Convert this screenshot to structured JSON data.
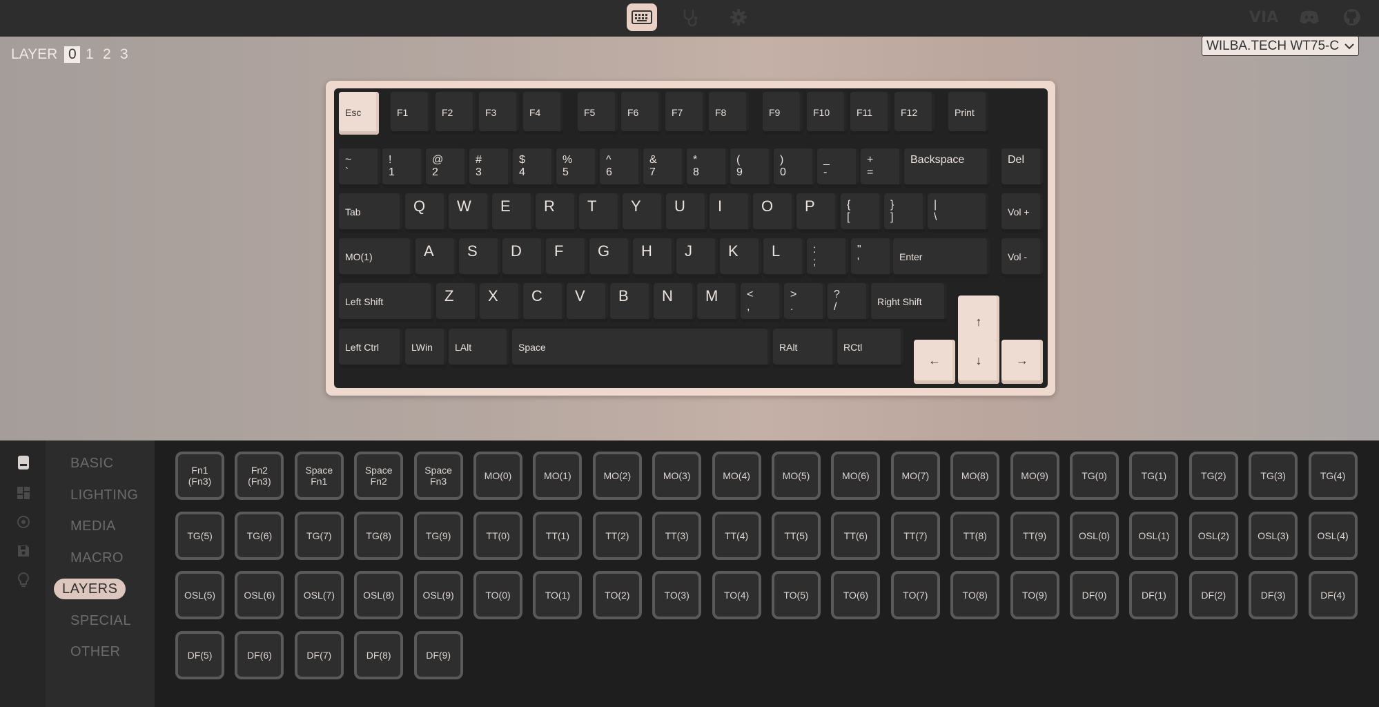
{
  "layer_selector": {
    "label": "LAYER",
    "layers": [
      "0",
      "1",
      "2",
      "3"
    ],
    "active": "0"
  },
  "device": {
    "name": "WILBA.TECH WT75-C"
  },
  "brand": {
    "via": "VIA"
  },
  "keyboard": {
    "row_f": [
      "Esc",
      "F1",
      "F2",
      "F3",
      "F4",
      "F5",
      "F6",
      "F7",
      "F8",
      "F9",
      "F10",
      "F11",
      "F12",
      "Print"
    ],
    "row_num": [
      {
        "top": "~",
        "bot": "`"
      },
      {
        "top": "!",
        "bot": "1"
      },
      {
        "top": "@",
        "bot": "2"
      },
      {
        "top": "#",
        "bot": "3"
      },
      {
        "top": "$",
        "bot": "4"
      },
      {
        "top": "%",
        "bot": "5"
      },
      {
        "top": "^",
        "bot": "6"
      },
      {
        "top": "&",
        "bot": "7"
      },
      {
        "top": "*",
        "bot": "8"
      },
      {
        "top": "(",
        "bot": "9"
      },
      {
        "top": ")",
        "bot": "0"
      },
      {
        "top": "_",
        "bot": "-"
      },
      {
        "top": "+",
        "bot": "="
      },
      {
        "top": "Backspace",
        "bot": ""
      },
      {
        "top": "Del",
        "bot": ""
      }
    ],
    "row_tab": [
      "Tab",
      "Q",
      "W",
      "E",
      "R",
      "T",
      "Y",
      "U",
      "I",
      "O",
      "P",
      {
        "top": "{",
        "bot": "["
      },
      {
        "top": "}",
        "bot": "]"
      },
      {
        "top": "|",
        "bot": "\\"
      },
      "Vol +"
    ],
    "row_caps": [
      "MO(1)",
      "A",
      "S",
      "D",
      "F",
      "G",
      "H",
      "J",
      "K",
      "L",
      {
        "top": ":",
        "bot": ";"
      },
      {
        "top": "\"",
        "bot": "'"
      },
      "Enter",
      "Vol -"
    ],
    "row_shift": [
      "Left Shift",
      "Z",
      "X",
      "C",
      "V",
      "B",
      "N",
      "M",
      {
        "top": "<",
        "bot": ","
      },
      {
        "top": ">",
        "bot": "."
      },
      {
        "top": "?",
        "bot": "/"
      },
      "Right Shift",
      "↑"
    ],
    "row_bottom": [
      "Left Ctrl",
      "LWin",
      "LAlt",
      "Space",
      "RAlt",
      "RCtl",
      "←",
      "↓",
      "→"
    ]
  },
  "categories": [
    "BASIC",
    "LIGHTING",
    "MEDIA",
    "MACRO",
    "LAYERS",
    "SPECIAL",
    "OTHER"
  ],
  "active_category": "LAYERS",
  "keycodes": [
    "Fn1\n(Fn3)",
    "Fn2\n(Fn3)",
    "Space\nFn1",
    "Space\nFn2",
    "Space\nFn3",
    "MO(0)",
    "MO(1)",
    "MO(2)",
    "MO(3)",
    "MO(4)",
    "MO(5)",
    "MO(6)",
    "MO(7)",
    "MO(8)",
    "MO(9)",
    "TG(0)",
    "TG(1)",
    "TG(2)",
    "TG(3)",
    "TG(4)",
    "TG(5)",
    "TG(6)",
    "TG(7)",
    "TG(8)",
    "TG(9)",
    "TT(0)",
    "TT(1)",
    "TT(2)",
    "TT(3)",
    "TT(4)",
    "TT(5)",
    "TT(6)",
    "TT(7)",
    "TT(8)",
    "TT(9)",
    "OSL(0)",
    "OSL(1)",
    "OSL(2)",
    "OSL(3)",
    "OSL(4)",
    "OSL(5)",
    "OSL(6)",
    "OSL(7)",
    "OSL(8)",
    "OSL(9)",
    "TO(0)",
    "TO(1)",
    "TO(2)",
    "TO(3)",
    "TO(4)",
    "TO(5)",
    "TO(6)",
    "TO(7)",
    "TO(8)",
    "TO(9)",
    "DF(0)",
    "DF(1)",
    "DF(2)",
    "DF(3)",
    "DF(4)",
    "DF(5)",
    "DF(6)",
    "DF(7)",
    "DF(8)",
    "DF(9)"
  ]
}
